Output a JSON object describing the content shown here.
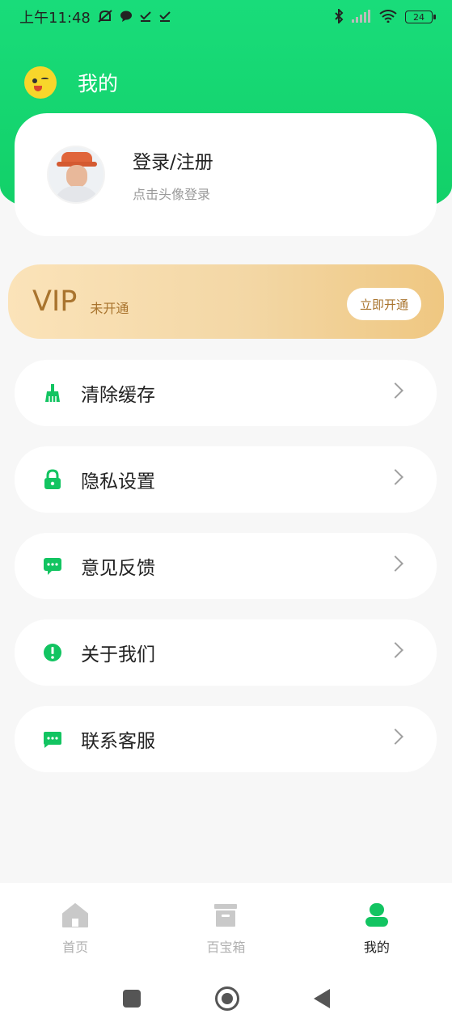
{
  "status_bar": {
    "time": "上午11:48",
    "battery": "24"
  },
  "header": {
    "title": "我的",
    "logo_icon": "smiley-face-icon"
  },
  "profile": {
    "login_title": "登录/注册",
    "login_hint": "点击头像登录"
  },
  "vip": {
    "label": "VIP",
    "status": "未开通",
    "button_label": "立即开通"
  },
  "menu": {
    "items": [
      {
        "label": "清除缓存",
        "icon": "broom-icon"
      },
      {
        "label": "隐私设置",
        "icon": "lock-icon"
      },
      {
        "label": "意见反馈",
        "icon": "chat-bubble-icon"
      },
      {
        "label": "关于我们",
        "icon": "info-circle-icon"
      },
      {
        "label": "联系客服",
        "icon": "message-icon"
      }
    ]
  },
  "bottom_nav": {
    "items": [
      {
        "label": "首页",
        "icon": "home-icon"
      },
      {
        "label": "百宝箱",
        "icon": "box-icon"
      },
      {
        "label": "我的",
        "icon": "user-icon",
        "active": true
      }
    ]
  },
  "colors": {
    "brand_green": "#12d068",
    "vip_gold": "#a9742e",
    "text_dark": "#222222",
    "text_muted": "#9a9a9a"
  }
}
